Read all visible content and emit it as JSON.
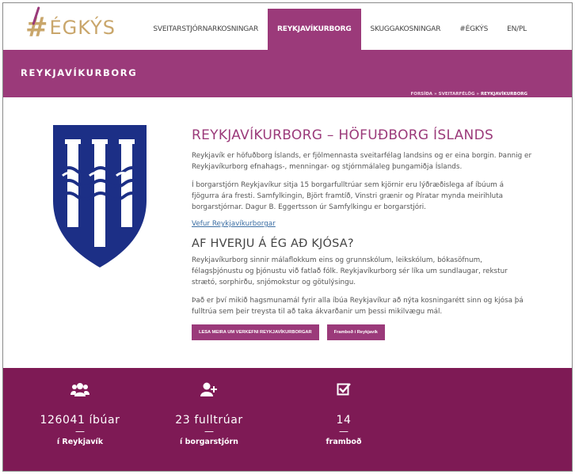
{
  "header": {
    "logo_text": "#ÉGKÝS",
    "nav": [
      {
        "label": "SVEITARSTJÓRNARKOSNINGAR",
        "active": false
      },
      {
        "label": "REYKJAVÍKURBORG",
        "active": true
      },
      {
        "label": "SKUGGAKOSNINGAR",
        "active": false
      },
      {
        "label": "#ÉGKÝS",
        "active": false
      },
      {
        "label": "EN/PL",
        "active": false
      }
    ]
  },
  "band": {
    "title": "REYKJAVÍKURBORG",
    "breadcrumb": {
      "home": "FORSÍÐA",
      "sep1": "»",
      "section": "SVEITARFÉLÖG",
      "sep2": "»",
      "current": "REYKJAVÍKURBORG"
    }
  },
  "main": {
    "heading": "REYKJAVÍKURBORG – HÖFUÐBORG ÍSLANDS",
    "para1": "Reykjavík er höfuðborg Íslands, er fjölmennasta sveitarfélag landsins og er eina borgin. Þannig er Reykjavíkurborg efnahags-, menningar- og stjórnmálaleg þungamiðja Íslands.",
    "para2": "Í borgarstjórn Reykjavíkur sitja 15 borgarfulltrúar sem kjörnir eru lýðræðislega af íbúum á fjögurra ára fresti. Samfylkingin, Björt framtíð, Vinstri grænir og Píratar mynda meirihluta borgarstjórnar. Dagur B. Eggertsson úr Samfylkingu er borgarstjóri.",
    "link": "Vefur Reykjavíkurborgar",
    "subheading": "AF HVERJU Á ÉG AÐ KJÓSA?",
    "para3": "Reykjavíkurborg sinnir málaflokkum eins og grunnskólum, leikskólum, bókasöfnum, félagsþjónustu og þjónustu við fatlað fólk. Reykjavíkurborg sér líka um sundlaugar, rekstur strætó, sorphirðu, snjómokstur og götulýsingu.",
    "para4": "Það er því mikið hagsmunamál fyrir alla íbúa Reykjavíkur að nýta kosningarétt sinn og kjósa þá fulltrúa sem þeir treysta til að taka ákvarðanir um þessi mikilvægu mál.",
    "button1": "LESA MEIRA UM VERKEFNI REYKJAVÍKURBORGAR",
    "button2": "Framboð í Reykjavík"
  },
  "stats": [
    {
      "icon": "users-icon",
      "number": "126041 íbúar",
      "dash": "—",
      "label": "í Reykjavík"
    },
    {
      "icon": "add-user-icon",
      "number": "23 fulltrúar",
      "dash": "—",
      "label": "í borgarstjórn"
    },
    {
      "icon": "checkbox-icon",
      "number": "14",
      "dash": "—",
      "label": "framboð"
    }
  ],
  "colors": {
    "brand": "#9b3a7a",
    "stats_bg": "#7e1a55",
    "shield_blue": "#1c2f86",
    "logo_gold": "#c9a66b"
  }
}
